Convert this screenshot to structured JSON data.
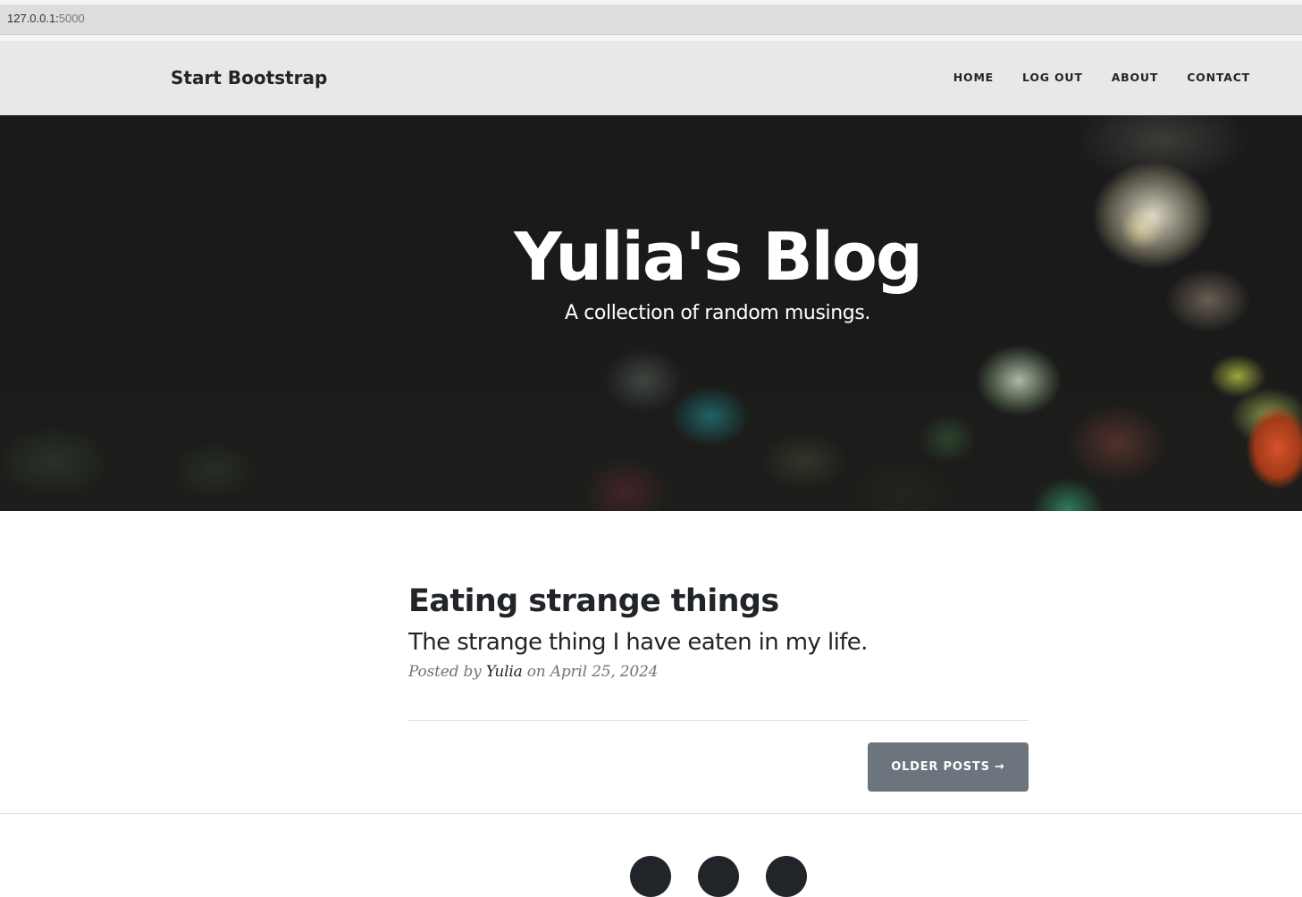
{
  "browser": {
    "url_host": "127.0.0.1:",
    "url_port": "5000"
  },
  "navbar": {
    "brand": "Start Bootstrap",
    "links": [
      {
        "label": "HOME"
      },
      {
        "label": "LOG OUT"
      },
      {
        "label": "ABOUT"
      },
      {
        "label": "CONTACT"
      }
    ]
  },
  "hero": {
    "title": "Yulia's Blog",
    "subtitle": "A collection of random musings."
  },
  "posts": [
    {
      "title": "Eating strange things",
      "subtitle": "The strange thing I have eaten in my life.",
      "meta_prefix": "Posted by",
      "author": "Yulia",
      "date_prefix": "on",
      "date": "April 25, 2024"
    }
  ],
  "pager": {
    "older_label": "OLDER POSTS →"
  },
  "footer": {
    "social_icons": [
      "social-icon-1",
      "social-icon-2",
      "social-icon-3"
    ]
  },
  "colors": {
    "button_bg": "#6c757d",
    "text": "#212529",
    "muted": "#6c757d"
  }
}
